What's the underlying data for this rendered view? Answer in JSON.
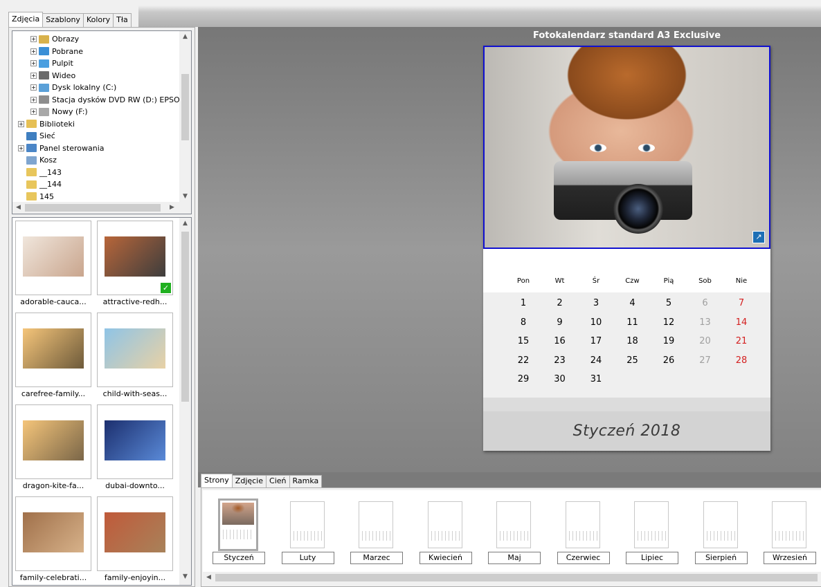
{
  "left_tabs": [
    "Zdjęcia",
    "Szablony",
    "Kolory",
    "Tła"
  ],
  "tree": [
    {
      "label": "Obrazy",
      "indent": 2,
      "expander": "+",
      "icon": "#d8b24c"
    },
    {
      "label": "Pobrane",
      "indent": 2,
      "expander": "+",
      "icon": "#3a8fd6"
    },
    {
      "label": "Pulpit",
      "indent": 2,
      "expander": "+",
      "icon": "#4a9fe0"
    },
    {
      "label": "Wideo",
      "indent": 2,
      "expander": "+",
      "icon": "#6b6b6b"
    },
    {
      "label": "Dysk lokalny (C:)",
      "indent": 2,
      "expander": "+",
      "icon": "#5aa0d8"
    },
    {
      "label": "Stacja dysków DVD RW (D:) EPSON",
      "indent": 2,
      "expander": "+",
      "icon": "#8d8d8d"
    },
    {
      "label": "Nowy (F:)",
      "indent": 2,
      "expander": "+",
      "icon": "#a8a8a8"
    },
    {
      "label": "Biblioteki",
      "indent": 1,
      "expander": "+",
      "icon": "#e6c055"
    },
    {
      "label": "Sieć",
      "indent": 1,
      "expander": "",
      "icon": "#3f7fc0"
    },
    {
      "label": "Panel sterowania",
      "indent": 1,
      "expander": "+",
      "icon": "#4b86c7"
    },
    {
      "label": "Kosz",
      "indent": 1,
      "expander": "",
      "icon": "#7fa5cf"
    },
    {
      "label": "__143",
      "indent": 1,
      "expander": "",
      "icon": "#e8c65c"
    },
    {
      "label": "__144",
      "indent": 1,
      "expander": "",
      "icon": "#e8c65c"
    },
    {
      "label": "145",
      "indent": 1,
      "expander": "",
      "icon": "#e8c65c"
    }
  ],
  "thumbnails": [
    {
      "caption": "adorable-cauca...",
      "checked": false,
      "colors": [
        "#f0e6dc",
        "#c9a58d"
      ]
    },
    {
      "caption": "attractive-redh...",
      "checked": true,
      "colors": [
        "#b8663a",
        "#3d3d3d"
      ]
    },
    {
      "caption": "carefree-family...",
      "checked": false,
      "colors": [
        "#f5c57a",
        "#6d5a3a"
      ]
    },
    {
      "caption": "child-with-seas...",
      "checked": false,
      "colors": [
        "#8fc4e6",
        "#e8d1a5"
      ]
    },
    {
      "caption": "dragon-kite-fa...",
      "checked": false,
      "colors": [
        "#f5c57a",
        "#7a6648"
      ]
    },
    {
      "caption": "dubai-downto...",
      "checked": false,
      "colors": [
        "#1c2f6e",
        "#5a8ad8"
      ]
    },
    {
      "caption": "family-celebrati...",
      "checked": false,
      "colors": [
        "#a0704a",
        "#d7b28a"
      ]
    },
    {
      "caption": "family-enjoyin...",
      "checked": false,
      "colors": [
        "#c05a3a",
        "#a8825a"
      ]
    }
  ],
  "calendar": {
    "title": "Fotokalendarz standard A3 Exclusive",
    "weekdays": [
      "Pon",
      "Wt",
      "Śr",
      "Czw",
      "Pią",
      "Sob",
      "Nie"
    ],
    "weeks": [
      [
        "1",
        "2",
        "3",
        "4",
        "5",
        "6",
        "7"
      ],
      [
        "8",
        "9",
        "10",
        "11",
        "12",
        "13",
        "14"
      ],
      [
        "15",
        "16",
        "17",
        "18",
        "19",
        "20",
        "21"
      ],
      [
        "22",
        "23",
        "24",
        "25",
        "26",
        "27",
        "28"
      ],
      [
        "29",
        "30",
        "31",
        "",
        "",
        "",
        ""
      ]
    ],
    "month_label": "Styczeń 2018",
    "weekend_saturday_color": "#a0a0a0",
    "weekend_sunday_color": "#d42020"
  },
  "bottom_tabs": [
    "Strony",
    "Zdjęcie",
    "Cień",
    "Ramka"
  ],
  "pages": [
    "Styczeń",
    "Luty",
    "Marzec",
    "Kwiecień",
    "Maj",
    "Czerwiec",
    "Lipiec",
    "Sierpień",
    "Wrzesień"
  ],
  "icons": {
    "scroll_up": "▲",
    "scroll_down": "▼",
    "scroll_left": "◀",
    "scroll_right": "▶",
    "expand": "+",
    "check": "✓",
    "resize": "↗"
  }
}
